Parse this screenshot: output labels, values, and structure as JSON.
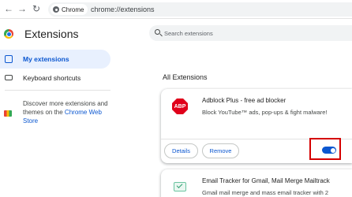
{
  "browser": {
    "back_icon": "arrow-left-icon",
    "forward_icon": "arrow-right-icon",
    "reload_icon": "reload-icon",
    "site_chip": "Chrome",
    "url": "chrome://extensions"
  },
  "header": {
    "title": "Extensions",
    "search_placeholder": "Search extensions"
  },
  "sidebar": {
    "items": [
      {
        "label": "My extensions",
        "active": true,
        "icon": "puzzle-icon"
      },
      {
        "label": "Keyboard shortcuts",
        "active": false,
        "icon": "keyboard-icon"
      }
    ],
    "discover_text": "Discover more extensions and themes on the ",
    "discover_link": "Chrome Web Store"
  },
  "main": {
    "section_title": "All Extensions",
    "extensions": [
      {
        "name": "Adblock Plus - free ad blocker",
        "description": "Block YouTube™ ads, pop-ups & fight malware!",
        "icon": "abp-icon",
        "details_label": "Details",
        "remove_label": "Remove",
        "enabled": true
      },
      {
        "name": "Email Tracker for Gmail, Mail Merge Mailtrack",
        "description": "Gmail mail merge and mass email tracker with 2",
        "icon": "mail-check-icon"
      }
    ]
  },
  "colors": {
    "accent": "#0b57d0",
    "active_bg": "#e8f0fe",
    "highlight": "#d50000",
    "abp_red": "#e0001b"
  }
}
